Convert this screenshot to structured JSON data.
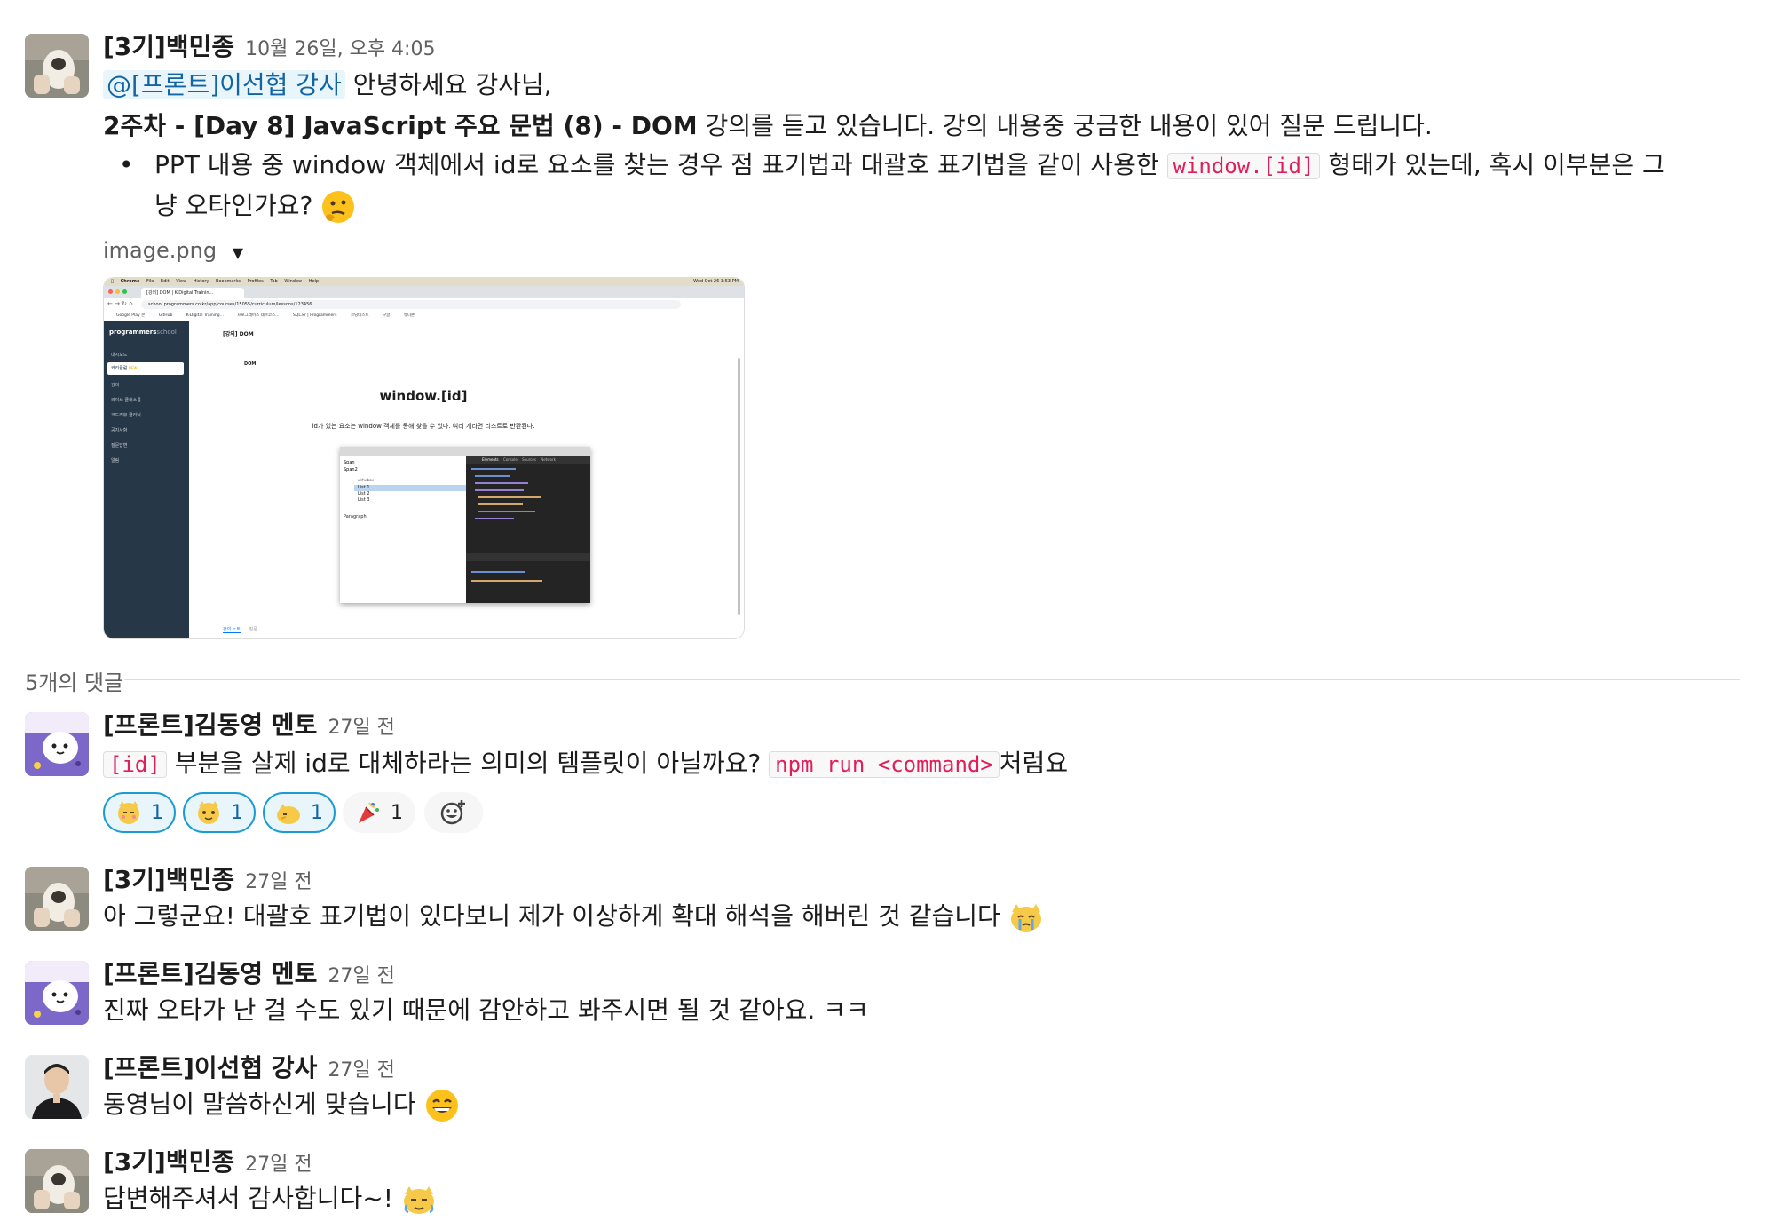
{
  "messages": {
    "first": {
      "author": "[3기]백민종",
      "time": "10월 26일, 오후 4:05",
      "mention": "@[프론트]이선협 강사",
      "greeting": "안녕하세요 강사님,",
      "lecture_bold": "2주차 - [Day 8] JavaScript 주요 문법 (8) - DOM",
      "lecture_rest": "강의를 듣고 있습니다. 강의 내용중 궁금한 내용이 있어 질문 드립니다.",
      "bullet_before": "PPT 내용 중 window 객체에서 id로 요소를 찾는 경우 점 표기법과 대괄호 표기법을 같이 사용한",
      "bullet_code": "window.[id]",
      "bullet_after": "형태가 있는데, 혹시 이부분은 그",
      "bullet_line2": "냥 오타인가요?",
      "bullet_emoji": "thinking-face",
      "attachment": {
        "filename": "image.png",
        "screenshot": {
          "menu": [
            "Chrome",
            "File",
            "Edit",
            "View",
            "History",
            "Bookmarks",
            "Profiles",
            "Tab",
            "Window",
            "Help"
          ],
          "clock": "Wed Oct 26 3:53 PM",
          "tab": "[강의] DOM | K-Digital Trainin...",
          "url": "school.programmers.co.kr/app/courses/15055/curriculum/lessons/123456",
          "bookmarks": [
            "Google Play 콘",
            "GitHub",
            "K-Digital Training...",
            "프로그래머스 데브코스...",
            "SQL.kr | Programmers",
            "코딩테스트",
            "구글",
            "유니온"
          ],
          "logo_main": "programmers",
          "logo_sub": "school",
          "sidebar_items": [
            "대시보드",
            "커리큘럼",
            "강의",
            "라이브 클래스룸",
            "코드리뷰 클리닉",
            "공지사항",
            "질문답변",
            "알림"
          ],
          "sidebar_badge": "NEW",
          "page_title": "[강의] DOM",
          "section": "DOM",
          "slide_title": "window.[id]",
          "slide_desc": "id가 있는 요소는 window 객체를 통해 찾을 수 있다. 여러 개라면 리스트로 반환된다.",
          "preview_lines": [
            "Span",
            "Span2"
          ],
          "preview_list": [
            "List 1",
            "List 2",
            "List 3"
          ],
          "preview_tooltip": "ul#ulbox",
          "preview_paragraph": "Paragraph",
          "devtools_tabs": [
            "Elements",
            "Console",
            "Sources",
            "Network"
          ],
          "footer_tabs": [
            "강의 노트",
            "질문"
          ]
        }
      }
    },
    "replies_count": "5개의 댓글",
    "reply1": {
      "author": "[프론트]김동영 멘토",
      "time": "27일 전",
      "code1": "[id]",
      "text_mid": "부분을 살제 id로 대체하라는 의미의 템플릿이 아닐까요?",
      "code2": "npm run <command>",
      "text_end": "처럼요",
      "reactions": [
        {
          "icon": "blushing-cat-emoji",
          "count": "1"
        },
        {
          "icon": "cat-face-emoji",
          "count": "1"
        },
        {
          "icon": "yellow-cat-emoji",
          "count": "1"
        },
        {
          "icon": "party-popper-emoji",
          "count": "1"
        }
      ],
      "add_reaction_icon": "add-reaction-icon"
    },
    "reply2": {
      "author": "[3기]백민종",
      "time": "27일 전",
      "text": "아 그렇군요! 대괄호 표기법이 있다보니 제가 이상하게 확대 해석을 해버린 것 같습니다",
      "emoji": "crying-cat-face"
    },
    "reply3": {
      "author": "[프론트]김동영 멘토",
      "time": "27일 전",
      "text": "진짜 오타가 난 걸 수도 있기 때문에 감안하고 봐주시면 될 것 같아요. ㅋㅋ"
    },
    "reply4": {
      "author": "[프론트]이선협 강사",
      "time": "27일 전",
      "text": "동영님이 말씀하신게 맞습니다",
      "emoji": "grinning-face"
    },
    "reply5": {
      "author": "[3기]백민종",
      "time": "27일 전",
      "text": "답변해주셔서 감사합니다~!",
      "emoji": "bowing-cat"
    }
  }
}
